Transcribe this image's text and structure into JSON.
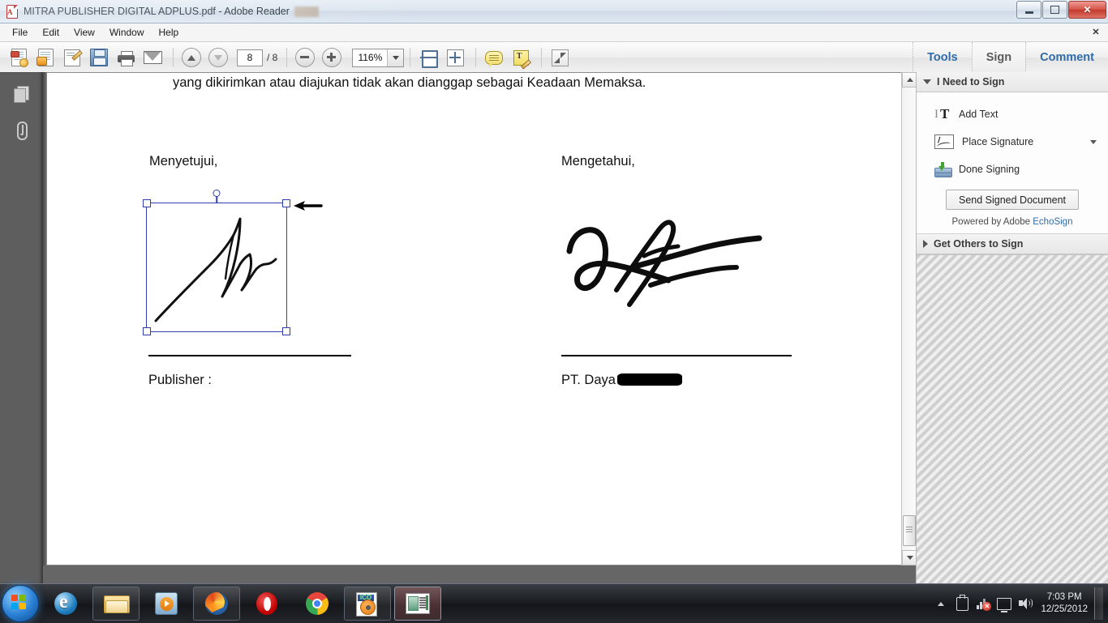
{
  "window": {
    "title": "MITRA PUBLISHER DIGITAL ADPLUS.pdf - Adobe Reader",
    "minimize_label": "",
    "maximize_label": "",
    "close_label": "✕"
  },
  "menu": {
    "items": [
      "File",
      "Edit",
      "View",
      "Window",
      "Help"
    ],
    "close_label": "✕"
  },
  "toolbar": {
    "icons": [
      {
        "name": "create-pdf-icon",
        "title": "Create PDF"
      },
      {
        "name": "export-pdf-icon",
        "title": "Export PDF"
      },
      {
        "name": "edit-pdf-icon",
        "title": "Edit PDF"
      },
      {
        "name": "save-icon",
        "title": "Save"
      },
      {
        "name": "print-icon",
        "title": "Print"
      },
      {
        "name": "email-icon",
        "title": "Email"
      }
    ],
    "page_current": "8",
    "page_total": "/ 8",
    "zoom_level": "116%",
    "fit_width_title": "Fit Width",
    "fit_page_title": "Fit Page",
    "comment_title": "Add Sticky Note",
    "text_tool_title": "Add Text Comment",
    "fullscreen_title": "Read Mode",
    "right_buttons": [
      {
        "label": "Tools",
        "active": false
      },
      {
        "label": "Sign",
        "active": true
      },
      {
        "label": "Comment",
        "active": false
      }
    ]
  },
  "nav_pane": {
    "thumbnails_title": "Page Thumbnails",
    "attachments_title": "Attachments"
  },
  "document": {
    "top_paragraph": "yang dikirimkan atau diajukan tidak akan dianggap sebagai Keadaan Memaksa.",
    "left_column": {
      "heading": "Menyetujui,",
      "label": "Publisher :"
    },
    "right_column": {
      "heading": "Mengetahui,",
      "label": "PT. Daya",
      "redacted": true
    },
    "selected_signature": {
      "selected": true,
      "handles": [
        "top-left",
        "top-right",
        "bottom-left",
        "bottom-right",
        "rotate"
      ]
    }
  },
  "sign_panel": {
    "sections": [
      {
        "title": "I Need to Sign",
        "expanded": true,
        "items": [
          {
            "label": "Add Text",
            "icon": "add-text-icon",
            "has_dropdown": false
          },
          {
            "label": "Place Signature",
            "icon": "place-signature-icon",
            "has_dropdown": true
          },
          {
            "label": "Done Signing",
            "icon": "done-signing-icon",
            "has_dropdown": false
          }
        ],
        "button": "Send Signed Document",
        "footer_prefix": "Powered by Adobe ",
        "footer_brand": "EchoSign"
      },
      {
        "title": "Get Others to Sign",
        "expanded": false,
        "items": [],
        "button": "",
        "footer_prefix": "",
        "footer_brand": ""
      }
    ]
  },
  "taskbar": {
    "start_title": "Start",
    "items": [
      {
        "name": "internet-explorer",
        "title": "Internet Explorer",
        "framed": false,
        "active": false
      },
      {
        "name": "windows-explorer",
        "title": "Windows Explorer",
        "framed": true,
        "active": false
      },
      {
        "name": "windows-media-player",
        "title": "Windows Media Player",
        "framed": false,
        "active": false
      },
      {
        "name": "firefox",
        "title": "Mozilla Firefox",
        "framed": true,
        "active": false
      },
      {
        "name": "opera",
        "title": "Opera",
        "framed": false,
        "active": false
      },
      {
        "name": "chrome",
        "title": "Google Chrome",
        "framed": false,
        "active": false
      },
      {
        "name": "ico-converter",
        "title": "ICO Converter",
        "framed": true,
        "active": false
      },
      {
        "name": "publisher-app",
        "title": "Publisher",
        "framed": true,
        "active": true
      }
    ],
    "tray": {
      "show_hidden_title": "Show hidden icons",
      "usb_title": "Safely Remove Hardware",
      "network_title": "No Internet access",
      "display_title": "Display",
      "volume_title": "Volume",
      "time": "7:03 PM",
      "date": "12/25/2012"
    }
  },
  "colors": {
    "accent_blue": "#2f6ca8",
    "selection_blue": "#2f3fae",
    "close_red": "#c0392b"
  }
}
